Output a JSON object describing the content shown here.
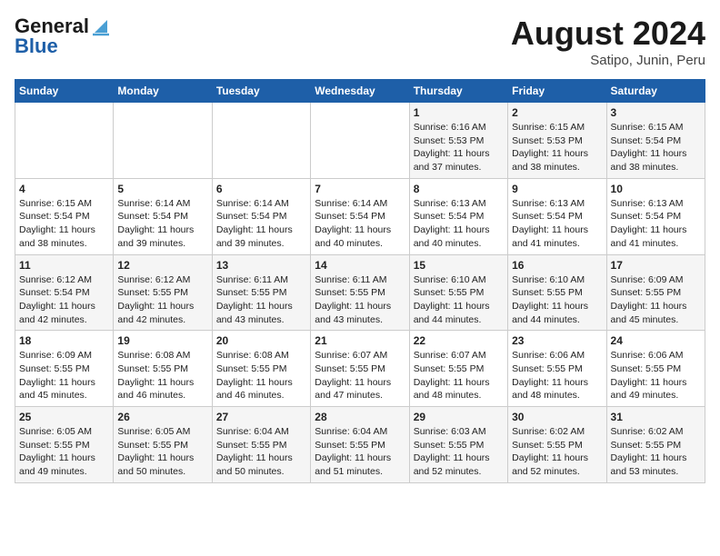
{
  "logo": {
    "line1": "General",
    "line2": "Blue"
  },
  "title": "August 2024",
  "subtitle": "Satipo, Junin, Peru",
  "weekdays": [
    "Sunday",
    "Monday",
    "Tuesday",
    "Wednesday",
    "Thursday",
    "Friday",
    "Saturday"
  ],
  "weeks": [
    [
      {
        "day": "",
        "content": ""
      },
      {
        "day": "",
        "content": ""
      },
      {
        "day": "",
        "content": ""
      },
      {
        "day": "",
        "content": ""
      },
      {
        "day": "1",
        "content": "Sunrise: 6:16 AM\nSunset: 5:53 PM\nDaylight: 11 hours and 37 minutes."
      },
      {
        "day": "2",
        "content": "Sunrise: 6:15 AM\nSunset: 5:53 PM\nDaylight: 11 hours and 38 minutes."
      },
      {
        "day": "3",
        "content": "Sunrise: 6:15 AM\nSunset: 5:54 PM\nDaylight: 11 hours and 38 minutes."
      }
    ],
    [
      {
        "day": "4",
        "content": "Sunrise: 6:15 AM\nSunset: 5:54 PM\nDaylight: 11 hours and 38 minutes."
      },
      {
        "day": "5",
        "content": "Sunrise: 6:14 AM\nSunset: 5:54 PM\nDaylight: 11 hours and 39 minutes."
      },
      {
        "day": "6",
        "content": "Sunrise: 6:14 AM\nSunset: 5:54 PM\nDaylight: 11 hours and 39 minutes."
      },
      {
        "day": "7",
        "content": "Sunrise: 6:14 AM\nSunset: 5:54 PM\nDaylight: 11 hours and 40 minutes."
      },
      {
        "day": "8",
        "content": "Sunrise: 6:13 AM\nSunset: 5:54 PM\nDaylight: 11 hours and 40 minutes."
      },
      {
        "day": "9",
        "content": "Sunrise: 6:13 AM\nSunset: 5:54 PM\nDaylight: 11 hours and 41 minutes."
      },
      {
        "day": "10",
        "content": "Sunrise: 6:13 AM\nSunset: 5:54 PM\nDaylight: 11 hours and 41 minutes."
      }
    ],
    [
      {
        "day": "11",
        "content": "Sunrise: 6:12 AM\nSunset: 5:54 PM\nDaylight: 11 hours and 42 minutes."
      },
      {
        "day": "12",
        "content": "Sunrise: 6:12 AM\nSunset: 5:55 PM\nDaylight: 11 hours and 42 minutes."
      },
      {
        "day": "13",
        "content": "Sunrise: 6:11 AM\nSunset: 5:55 PM\nDaylight: 11 hours and 43 minutes."
      },
      {
        "day": "14",
        "content": "Sunrise: 6:11 AM\nSunset: 5:55 PM\nDaylight: 11 hours and 43 minutes."
      },
      {
        "day": "15",
        "content": "Sunrise: 6:10 AM\nSunset: 5:55 PM\nDaylight: 11 hours and 44 minutes."
      },
      {
        "day": "16",
        "content": "Sunrise: 6:10 AM\nSunset: 5:55 PM\nDaylight: 11 hours and 44 minutes."
      },
      {
        "day": "17",
        "content": "Sunrise: 6:09 AM\nSunset: 5:55 PM\nDaylight: 11 hours and 45 minutes."
      }
    ],
    [
      {
        "day": "18",
        "content": "Sunrise: 6:09 AM\nSunset: 5:55 PM\nDaylight: 11 hours and 45 minutes."
      },
      {
        "day": "19",
        "content": "Sunrise: 6:08 AM\nSunset: 5:55 PM\nDaylight: 11 hours and 46 minutes."
      },
      {
        "day": "20",
        "content": "Sunrise: 6:08 AM\nSunset: 5:55 PM\nDaylight: 11 hours and 46 minutes."
      },
      {
        "day": "21",
        "content": "Sunrise: 6:07 AM\nSunset: 5:55 PM\nDaylight: 11 hours and 47 minutes."
      },
      {
        "day": "22",
        "content": "Sunrise: 6:07 AM\nSunset: 5:55 PM\nDaylight: 11 hours and 48 minutes."
      },
      {
        "day": "23",
        "content": "Sunrise: 6:06 AM\nSunset: 5:55 PM\nDaylight: 11 hours and 48 minutes."
      },
      {
        "day": "24",
        "content": "Sunrise: 6:06 AM\nSunset: 5:55 PM\nDaylight: 11 hours and 49 minutes."
      }
    ],
    [
      {
        "day": "25",
        "content": "Sunrise: 6:05 AM\nSunset: 5:55 PM\nDaylight: 11 hours and 49 minutes."
      },
      {
        "day": "26",
        "content": "Sunrise: 6:05 AM\nSunset: 5:55 PM\nDaylight: 11 hours and 50 minutes."
      },
      {
        "day": "27",
        "content": "Sunrise: 6:04 AM\nSunset: 5:55 PM\nDaylight: 11 hours and 50 minutes."
      },
      {
        "day": "28",
        "content": "Sunrise: 6:04 AM\nSunset: 5:55 PM\nDaylight: 11 hours and 51 minutes."
      },
      {
        "day": "29",
        "content": "Sunrise: 6:03 AM\nSunset: 5:55 PM\nDaylight: 11 hours and 52 minutes."
      },
      {
        "day": "30",
        "content": "Sunrise: 6:02 AM\nSunset: 5:55 PM\nDaylight: 11 hours and 52 minutes."
      },
      {
        "day": "31",
        "content": "Sunrise: 6:02 AM\nSunset: 5:55 PM\nDaylight: 11 hours and 53 minutes."
      }
    ]
  ]
}
